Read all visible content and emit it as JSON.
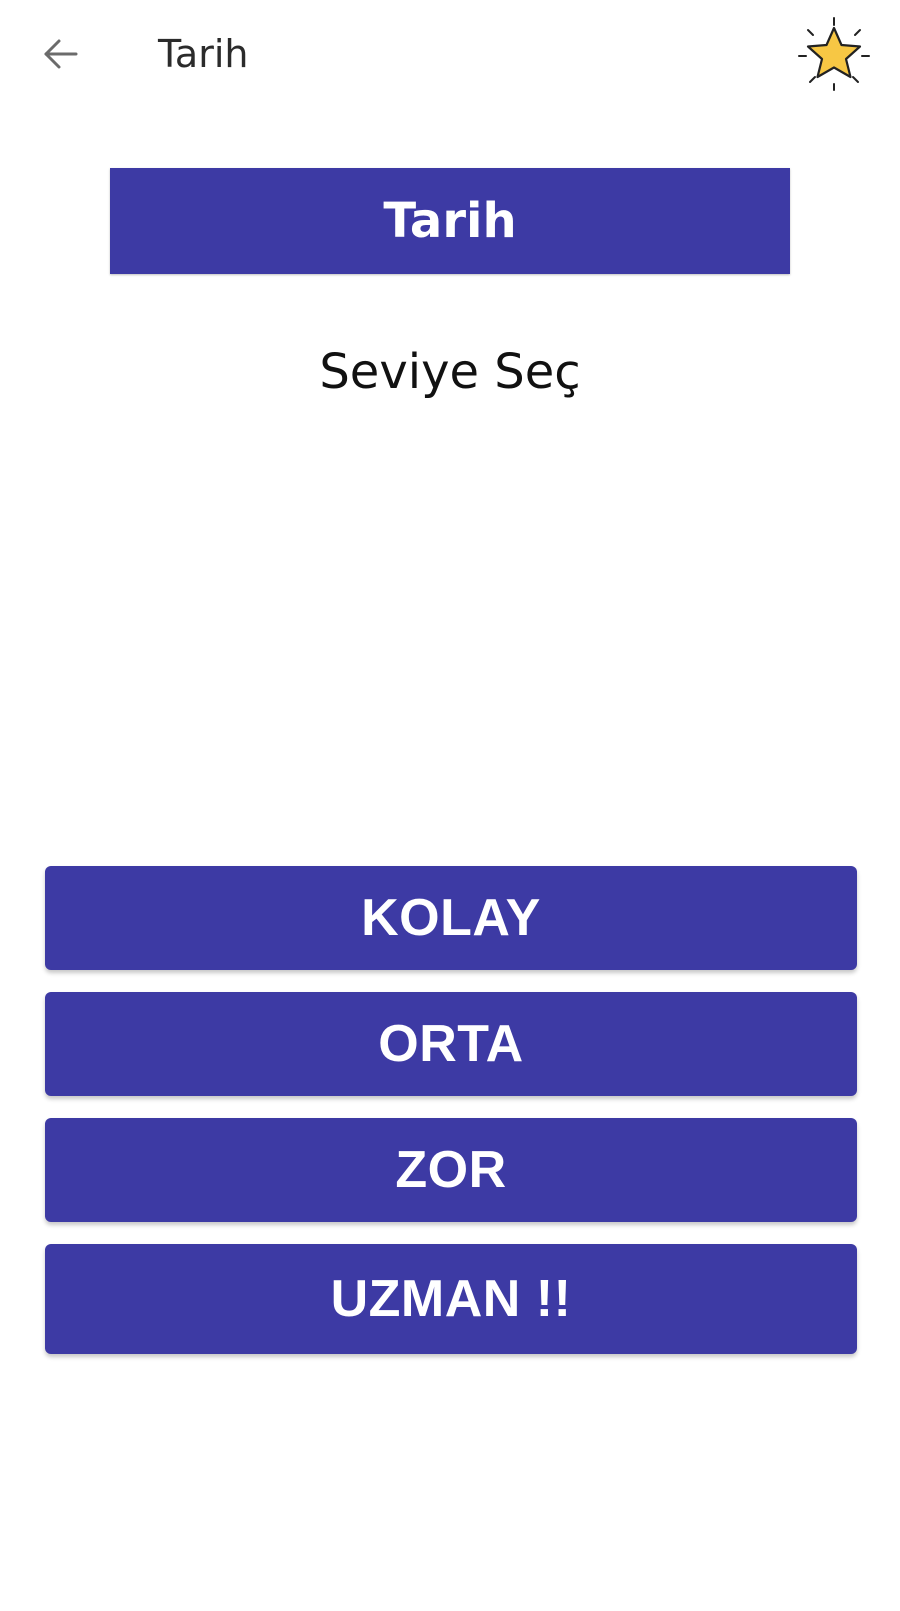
{
  "app_bar": {
    "title": "Tarih",
    "back_icon": "arrow-left-icon",
    "star_icon": "star-icon"
  },
  "banner": {
    "label": "Tarih"
  },
  "heading": {
    "text": "Seviye Seç"
  },
  "levels": [
    {
      "label": "KOLAY"
    },
    {
      "label": "ORTA"
    },
    {
      "label": "ZOR"
    },
    {
      "label": "UZMAN !!"
    }
  ],
  "colors": {
    "primary": "#3d3aa4",
    "star_fill": "#f7c744",
    "text_dark": "#111111"
  }
}
